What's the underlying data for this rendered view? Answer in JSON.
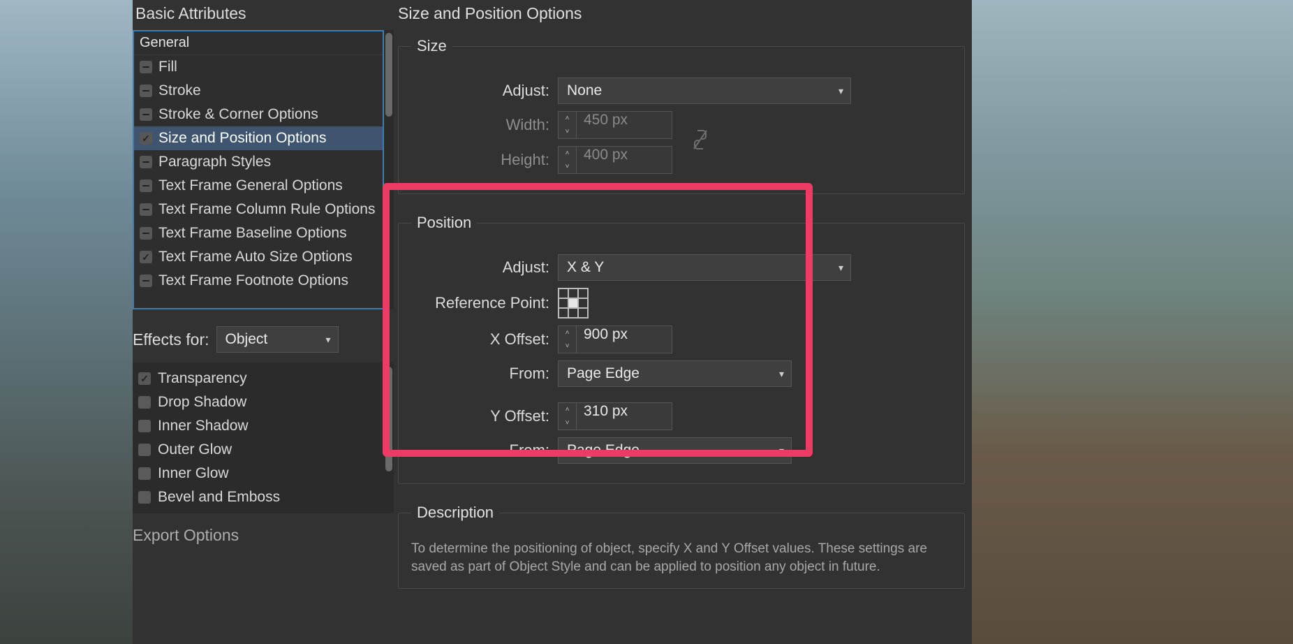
{
  "sidebar": {
    "title": "Basic Attributes",
    "items": [
      {
        "label": "General",
        "state": "top"
      },
      {
        "label": "Fill",
        "state": "dash"
      },
      {
        "label": "Stroke",
        "state": "dash"
      },
      {
        "label": "Stroke & Corner Options",
        "state": "dash"
      },
      {
        "label": "Size and Position Options",
        "state": "on",
        "selected": true
      },
      {
        "label": "Paragraph Styles",
        "state": "dash"
      },
      {
        "label": "Text Frame General Options",
        "state": "dash"
      },
      {
        "label": "Text Frame Column Rule Options",
        "state": "dash"
      },
      {
        "label": "Text Frame Baseline Options",
        "state": "dash"
      },
      {
        "label": "Text Frame Auto Size Options",
        "state": "on"
      },
      {
        "label": "Text Frame Footnote Options",
        "state": "dash"
      }
    ],
    "effects_label": "Effects for:",
    "effects_value": "Object",
    "effects_items": [
      {
        "label": "Transparency",
        "state": "on"
      },
      {
        "label": "Drop Shadow",
        "state": "off"
      },
      {
        "label": "Inner Shadow",
        "state": "off"
      },
      {
        "label": "Outer Glow",
        "state": "off"
      },
      {
        "label": "Inner Glow",
        "state": "off"
      },
      {
        "label": "Bevel and Emboss",
        "state": "off"
      }
    ],
    "export_title": "Export Options"
  },
  "main": {
    "title": "Size and Position Options",
    "size": {
      "legend": "Size",
      "adjust_label": "Adjust:",
      "adjust_value": "None",
      "width_label": "Width:",
      "width_value": "450 px",
      "height_label": "Height:",
      "height_value": "400 px"
    },
    "position": {
      "legend": "Position",
      "adjust_label": "Adjust:",
      "adjust_value": "X & Y",
      "ref_label": "Reference Point:",
      "x_label": "X Offset:",
      "x_value": "900 px",
      "x_from_label": "From:",
      "x_from_value": "Page Edge",
      "y_label": "Y Offset:",
      "y_value": "310 px",
      "y_from_label": "From:",
      "y_from_value": "Page Edge"
    },
    "description": {
      "legend": "Description",
      "text": "To determine the positioning of object, specify X and Y Offset values. These settings are saved as part of Object Style and can be applied to position any object in future."
    }
  }
}
